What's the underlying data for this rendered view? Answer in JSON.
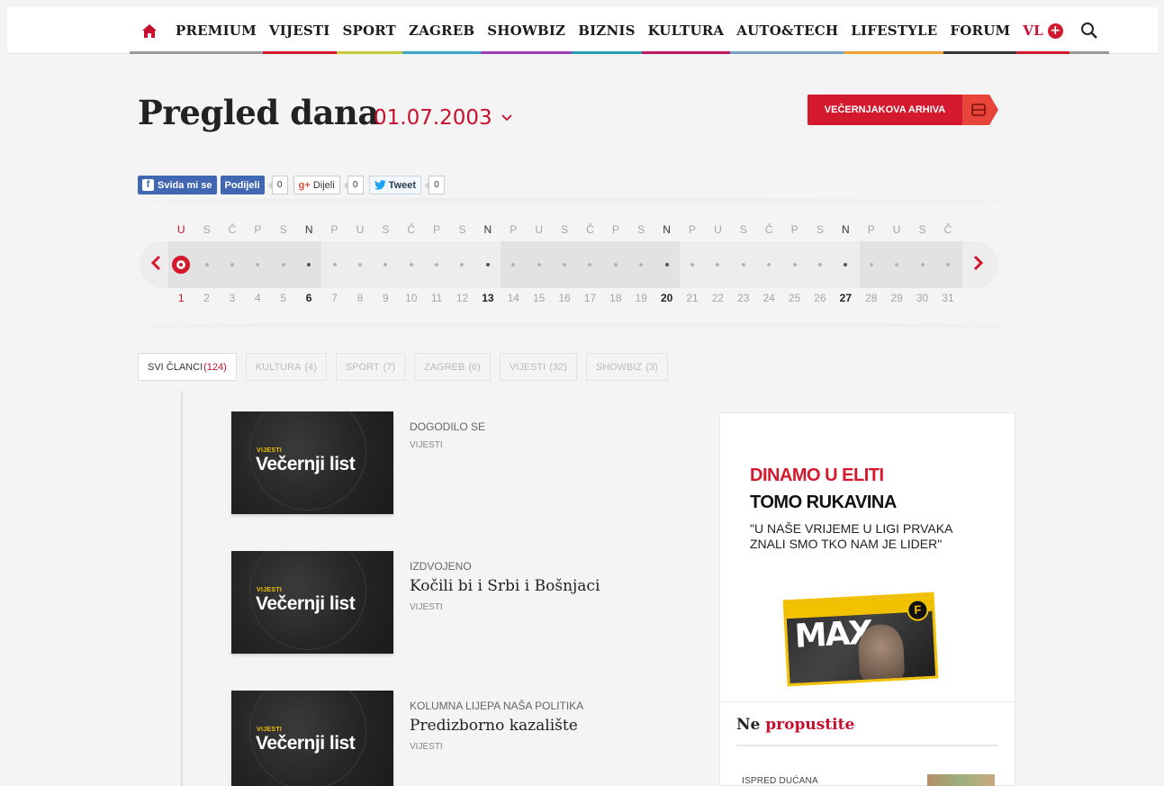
{
  "nav": {
    "items": [
      {
        "label": "PREMIUM",
        "color": "#9a9a9a"
      },
      {
        "label": "VIJESTI",
        "color": "#d4182e"
      },
      {
        "label": "SPORT",
        "color": "#c7c93a"
      },
      {
        "label": "ZAGREB",
        "color": "#3aa5c3"
      },
      {
        "label": "SHOWBIZ",
        "color": "#9b3fb5"
      },
      {
        "label": "BIZNIS",
        "color": "#2a9bb0"
      },
      {
        "label": "KULTURA",
        "color": "#c2185b"
      },
      {
        "label": "AUTO&TECH",
        "color": "#7aa0c4"
      },
      {
        "label": "LIFESTYLE",
        "color": "#f0a030"
      },
      {
        "label": "FORUM",
        "color": "#333333"
      }
    ],
    "vl_label": "VL"
  },
  "page": {
    "title": "Pregled dana",
    "date": "01.07.2003",
    "archive_label": "VEČERNJAKOVA ARHIVA"
  },
  "social": {
    "fb_like": "Svida mi se",
    "fb_share": "Podijeli",
    "fb_count": "0",
    "gplus_label": "Dijeli",
    "gplus_count": "0",
    "tweet_label": "Tweet",
    "tweet_count": "0"
  },
  "calendar": {
    "days": [
      "U",
      "S",
      "Č",
      "P",
      "S",
      "N",
      "P",
      "U",
      "S",
      "Č",
      "P",
      "S",
      "N",
      "P",
      "U",
      "S",
      "Č",
      "P",
      "S",
      "N",
      "P",
      "U",
      "S",
      "Č",
      "P",
      "S",
      "N",
      "P",
      "U",
      "S",
      "Č"
    ],
    "dates": [
      "1",
      "2",
      "3",
      "4",
      "5",
      "6",
      "7",
      "8",
      "9",
      "10",
      "11",
      "12",
      "13",
      "14",
      "15",
      "16",
      "17",
      "18",
      "19",
      "20",
      "21",
      "22",
      "23",
      "24",
      "25",
      "26",
      "27",
      "28",
      "29",
      "30",
      "31"
    ],
    "selected": "1"
  },
  "tabs": [
    {
      "label": "SVI ČLANCI",
      "count": "(124)"
    },
    {
      "label": "KULTURA",
      "count": "(4)"
    },
    {
      "label": "SPORT",
      "count": "(7)"
    },
    {
      "label": "ZAGREB",
      "count": "(6)"
    },
    {
      "label": "VIJESTI",
      "count": "(32)"
    },
    {
      "label": "SHOWBIZ",
      "count": "(3)"
    }
  ],
  "articles": [
    {
      "category": "DOGODILO SE",
      "title": "",
      "section": "VIJESTI",
      "thumb_kicker": "VIJESTI",
      "thumb_brand": "Večernji list"
    },
    {
      "category": "IZDVOJENO",
      "title": "Kočili bi i Srbi i Bošnjaci",
      "section": "VIJESTI",
      "thumb_kicker": "VIJESTI",
      "thumb_brand": "Večernji list"
    },
    {
      "category": "KOLUMNA LIJEPA NAŠA POLITIKA",
      "title": "Predizborno kazalište",
      "section": "VIJESTI",
      "thumb_kicker": "VIJESTI",
      "thumb_brand": "Večernji list"
    }
  ],
  "ad": {
    "headline_red": "DINAMO U ELITI",
    "headline_black": "TOMO RUKAVINA",
    "quote": "\"U NAŠE VRIJEME U LIGI PRVAKA ZNALI SMO TKO NAM JE LIDER\"",
    "magazine": "MAX",
    "magazine_badge": "F"
  },
  "missed": {
    "title_plain": "Ne",
    "title_red": "propustite",
    "first_item": "ISPRED DUĆANA"
  },
  "colors": {
    "accent": "#d4182e"
  }
}
